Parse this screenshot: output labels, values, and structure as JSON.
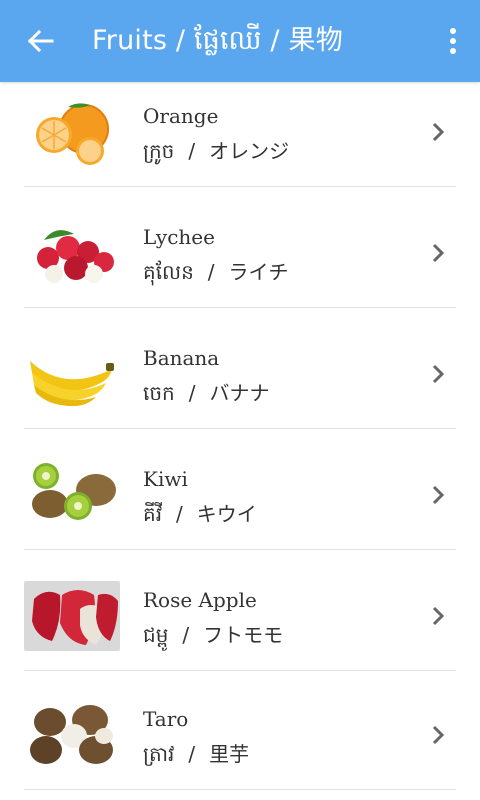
{
  "appbar": {
    "title": "Fruits / ផ្លែឈើ / 果物",
    "back_icon": "arrow-left-icon",
    "more_icon": "more-vert-icon",
    "color": "#5aa7f0"
  },
  "items": [
    {
      "name": "Orange",
      "khmer": "ក្រូច",
      "japanese": "オレンジ",
      "image": "orange"
    },
    {
      "name": "Lychee",
      "khmer": "គុលែន",
      "japanese": "ライチ",
      "image": "lychee"
    },
    {
      "name": "Banana",
      "khmer": "ចេក",
      "japanese": "バナナ",
      "image": "banana"
    },
    {
      "name": "Kiwi",
      "khmer": "គីវី",
      "japanese": "キウイ",
      "image": "kiwi"
    },
    {
      "name": "Rose Apple",
      "khmer": "ជម្ពូ",
      "japanese": "フトモモ",
      "image": "rose-apple"
    },
    {
      "name": "Taro",
      "khmer": "ត្រាវ",
      "japanese": "里芋",
      "image": "taro"
    }
  ],
  "separator": "/"
}
